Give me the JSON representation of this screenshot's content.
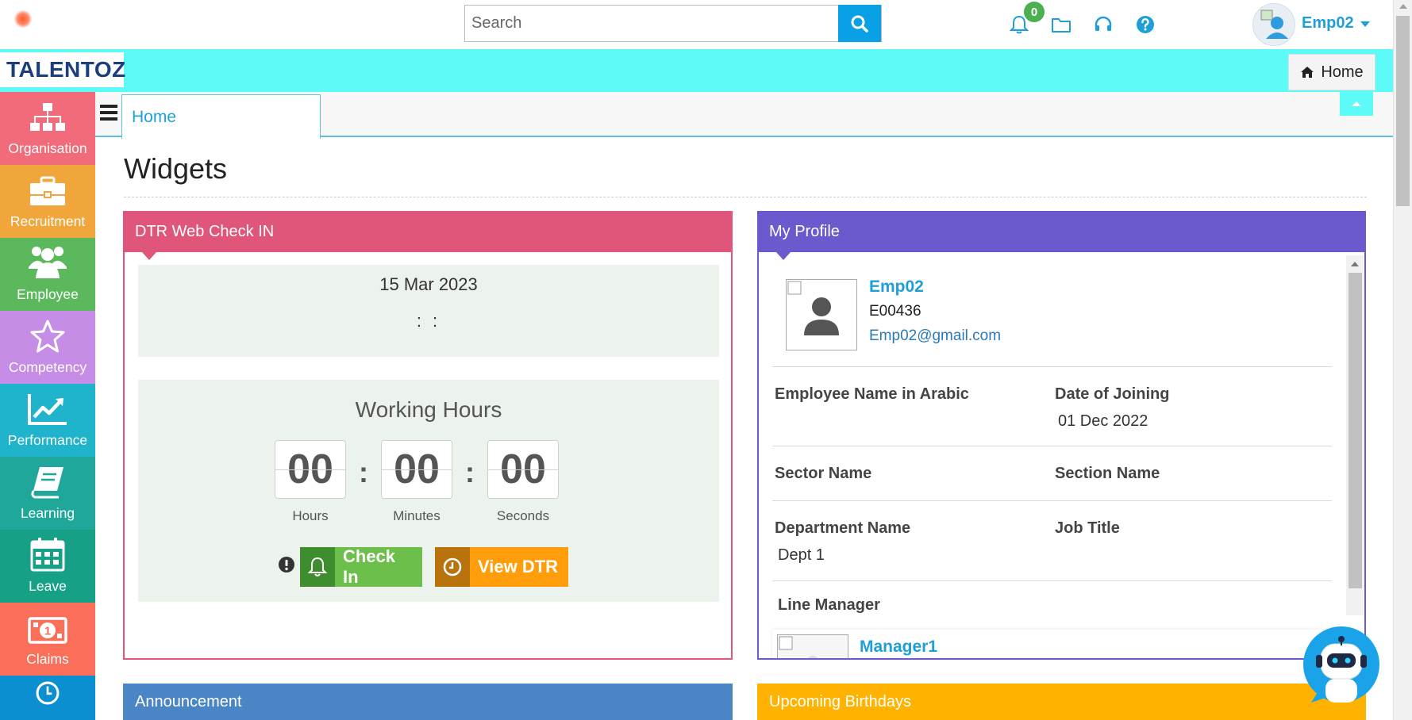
{
  "header": {
    "search_placeholder": "Search",
    "notifications_count": "0",
    "user_name": "Emp02"
  },
  "brand": {
    "logo_text": "TALENTOZ"
  },
  "home_button": {
    "label": "Home"
  },
  "sidebar": {
    "items": [
      {
        "label": "Organisation",
        "color": "#f26b7a",
        "icon": "org-chart-icon"
      },
      {
        "label": "Recruitment",
        "color": "#f0a63a",
        "icon": "briefcase-icon"
      },
      {
        "label": "Employee",
        "color": "#5cb85c",
        "icon": "users-icon"
      },
      {
        "label": "Competency",
        "color": "#c58de6",
        "icon": "star-icon"
      },
      {
        "label": "Performance",
        "color": "#20b4cc",
        "icon": "chart-line-icon"
      },
      {
        "label": "Learning",
        "color": "#1fa89a",
        "icon": "book-icon"
      },
      {
        "label": "Leave",
        "color": "#16a085",
        "icon": "calendar-icon"
      },
      {
        "label": "Claims",
        "color": "#fa6e5a",
        "icon": "money-icon"
      },
      {
        "label": "",
        "color": "#0c8fd0",
        "icon": "clock-icon"
      }
    ]
  },
  "tabs": {
    "active_label": "Home"
  },
  "page": {
    "title": "Widgets"
  },
  "dtr": {
    "title": "DTR Web Check IN",
    "date": "15 Mar 2023",
    "time": ": :",
    "working_hours_title": "Working Hours",
    "hours": "00",
    "minutes": "00",
    "seconds": "00",
    "hours_label": "Hours",
    "minutes_label": "Minutes",
    "seconds_label": "Seconds",
    "check_in_label": "Check In",
    "view_dtr_label": "View DTR"
  },
  "profile": {
    "title": "My Profile",
    "name": "Emp02",
    "code": "E00436",
    "email": "Emp02@gmail.com",
    "fields": {
      "arabic_name_label": "Employee Name in Arabic",
      "arabic_name_value": "",
      "joining_label": "Date of Joining",
      "joining_value": "01 Dec 2022",
      "sector_label": "Sector Name",
      "sector_value": "",
      "section_label": "Section Name",
      "section_value": "",
      "department_label": "Department Name",
      "department_value": "Dept 1",
      "job_title_label": "Job Title",
      "job_title_value": "",
      "line_manager_label": "Line Manager",
      "line_manager_name": "Manager1"
    }
  },
  "announcement": {
    "title": "Announcement"
  },
  "birthdays": {
    "title": "Upcoming Birthdays"
  }
}
